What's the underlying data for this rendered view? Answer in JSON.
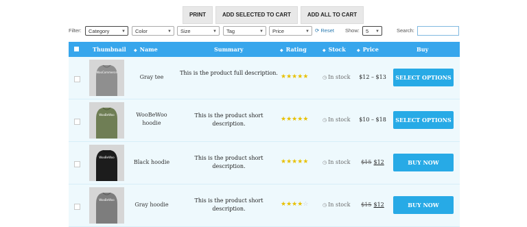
{
  "actions": {
    "print": "PRINT",
    "add_selected": "ADD SELECTED TO CART",
    "add_all": "ADD ALL TO CART"
  },
  "filters": {
    "label": "Filter:",
    "category": "Category",
    "color": "Color",
    "size": "Size",
    "tag": "Tag",
    "price": "Price",
    "reset": "Reset",
    "show_label": "Show:",
    "show_value": "5",
    "search_label": "Search:",
    "search_value": ""
  },
  "columns": {
    "thumbnail": "Thumbnail",
    "name": "Name",
    "summary": "Summary",
    "rating": "Rating",
    "stock": "Stock",
    "price": "Price",
    "buy": "Buy"
  },
  "colors": {
    "header": "#37a6ec",
    "buy_button": "#27aae6",
    "row_bg": "#eef9fd",
    "star": "#e8c000"
  },
  "products": [
    {
      "name": "Gray tee",
      "summary": "This is the product full description.",
      "rating": 5,
      "stock": "In stock",
      "price_old": "",
      "price": "$12 – $13",
      "buy": "SELECT OPTIONS",
      "shirt_color": "#8f8f8f",
      "print_text": "WooCommerce"
    },
    {
      "name": "WooBeWoo hoodie",
      "summary": "This is the product short description.",
      "rating": 5,
      "stock": "In stock",
      "price_old": "",
      "price": "$10 – $18",
      "buy": "SELECT OPTIONS",
      "shirt_color": "#6f7e55",
      "print_text": "WooBeWoo"
    },
    {
      "name": "Black hoodie",
      "summary": "This is the product short description.",
      "rating": 5,
      "stock": "In stock",
      "price_old": "$15",
      "price": "$12",
      "buy": "BUY NOW",
      "shirt_color": "#1c1c1c",
      "print_text": "WooBeWoo"
    },
    {
      "name": "Gray hoodie",
      "summary": "This is the product short description.",
      "rating": 4,
      "stock": "In stock",
      "price_old": "$15",
      "price": "$12",
      "buy": "BUY NOW",
      "shirt_color": "#7d7d7d",
      "print_text": "WooBeWoo"
    }
  ]
}
